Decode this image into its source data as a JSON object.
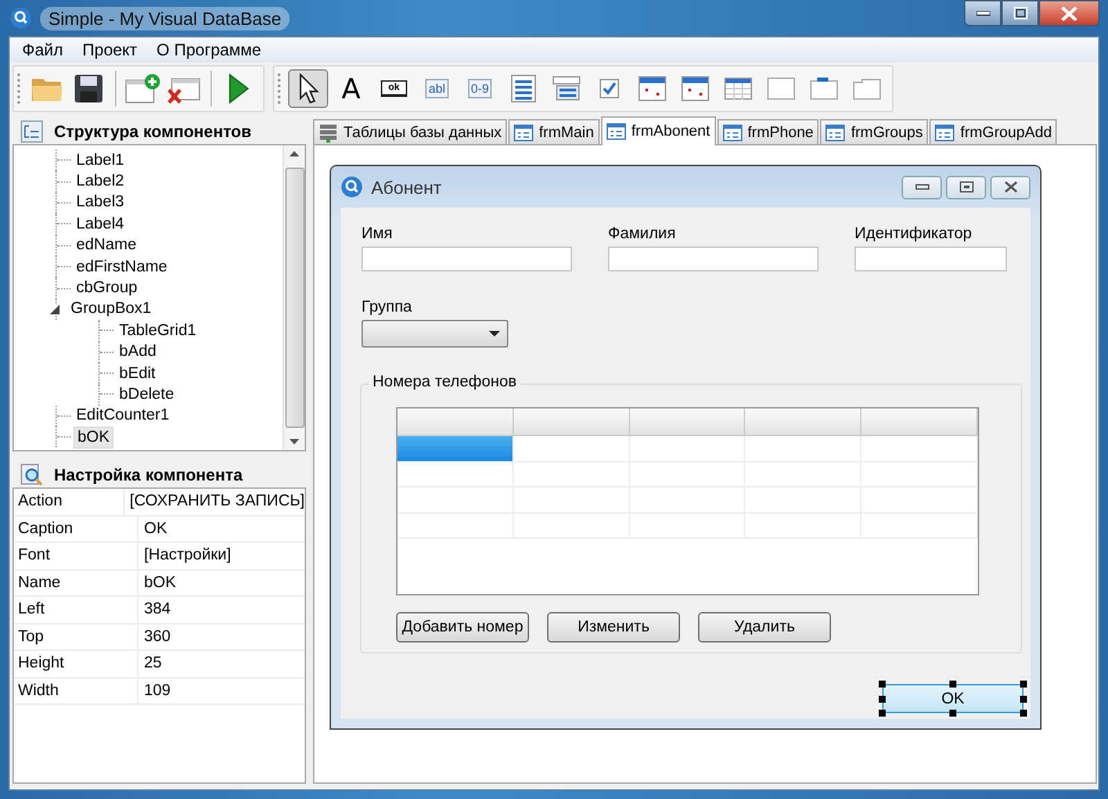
{
  "window": {
    "title": "Simple - My Visual DataBase"
  },
  "menu": [
    "Файл",
    "Проект",
    "О Программе"
  ],
  "toolbar": [
    {
      "kind": "open"
    },
    {
      "kind": "save"
    },
    {
      "kind": "sep"
    },
    {
      "kind": "new-form"
    },
    {
      "kind": "delete-form"
    },
    {
      "kind": "sep"
    },
    {
      "kind": "run"
    }
  ],
  "palette": [
    {
      "kind": "pointer",
      "selected": true
    },
    {
      "kind": "label",
      "label": "A",
      "selected": false
    },
    {
      "kind": "button",
      "label": "ok",
      "selected": false
    },
    {
      "kind": "edit",
      "label": "abl",
      "selected": false
    },
    {
      "kind": "counter",
      "label": "0-9",
      "selected": false
    },
    {
      "kind": "memo",
      "selected": false
    },
    {
      "kind": "combo",
      "selected": false
    },
    {
      "kind": "checkbox",
      "selected": false
    },
    {
      "kind": "datetime",
      "selected": false
    },
    {
      "kind": "calendar",
      "selected": false
    },
    {
      "kind": "grid",
      "selected": false
    },
    {
      "kind": "panel",
      "selected": false
    },
    {
      "kind": "groupbox",
      "selected": false
    },
    {
      "kind": "tabs",
      "selected": false
    }
  ],
  "structure": {
    "title": "Структура компонентов",
    "items": [
      {
        "label": "Label1",
        "selected": false
      },
      {
        "label": "Label2",
        "selected": false
      },
      {
        "label": "Label3",
        "selected": false
      },
      {
        "label": "Label4",
        "selected": false
      },
      {
        "label": "edName",
        "selected": false
      },
      {
        "label": "edFirstName",
        "selected": false
      },
      {
        "label": "cbGroup",
        "selected": false
      },
      {
        "label": "GroupBox1",
        "selected": false,
        "expanded": true,
        "children": [
          {
            "label": "TableGrid1",
            "selected": false
          },
          {
            "label": "bAdd",
            "selected": false
          },
          {
            "label": "bEdit",
            "selected": false
          },
          {
            "label": "bDelete",
            "selected": false
          }
        ]
      },
      {
        "label": "EditCounter1",
        "selected": false
      },
      {
        "label": "bOK",
        "selected": true
      }
    ]
  },
  "properties": {
    "title": "Настройка компонента",
    "rows": [
      {
        "name": "Action",
        "value": "[СОХРАНИТЬ ЗАПИСЬ]"
      },
      {
        "name": "Caption",
        "value": "OK"
      },
      {
        "name": "Font",
        "value": "[Настройки]"
      },
      {
        "name": "Name",
        "value": "bOK"
      },
      {
        "name": "Left",
        "value": "384"
      },
      {
        "name": "Top",
        "value": "360"
      },
      {
        "name": "Height",
        "value": "25"
      },
      {
        "name": "Width",
        "value": "109"
      }
    ]
  },
  "tabs": [
    {
      "label": "Таблицы базы данных",
      "kind": "database",
      "selected": false
    },
    {
      "label": "frmMain",
      "kind": "form",
      "selected": false
    },
    {
      "label": "frmAbonent",
      "kind": "form",
      "selected": true
    },
    {
      "label": "frmPhone",
      "kind": "form",
      "selected": false
    },
    {
      "label": "frmGroups",
      "kind": "form",
      "selected": false
    },
    {
      "label": "frmGroupAdd",
      "kind": "form",
      "selected": false
    }
  ],
  "form": {
    "title": "Абонент",
    "fields": [
      {
        "label": "Имя"
      },
      {
        "label": "Фамилия"
      },
      {
        "label": "Идентификатор"
      }
    ],
    "group": {
      "label": "Группа"
    },
    "groupbox": {
      "title": "Номера телефонов",
      "grid": {
        "rows": [
          {
            "cells": [
              {
                "selected": true
              },
              {
                "selected": false
              },
              {
                "selected": false
              },
              {
                "selected": false
              },
              {
                "selected": false
              }
            ]
          },
          {
            "cells": [
              {
                "selected": false
              },
              {
                "selected": false
              },
              {
                "selected": false
              },
              {
                "selected": false
              },
              {
                "selected": false
              }
            ]
          },
          {
            "cells": [
              {
                "selected": false
              },
              {
                "selected": false
              },
              {
                "selected": false
              },
              {
                "selected": false
              },
              {
                "selected": false
              }
            ]
          },
          {
            "cells": [
              {
                "selected": false
              },
              {
                "selected": false
              },
              {
                "selected": false
              },
              {
                "selected": false
              },
              {
                "selected": false
              }
            ]
          }
        ]
      },
      "buttons": [
        "Добавить номер",
        "Изменить",
        "Удалить"
      ]
    },
    "ok_button": {
      "label": "OK",
      "selected": true
    }
  }
}
